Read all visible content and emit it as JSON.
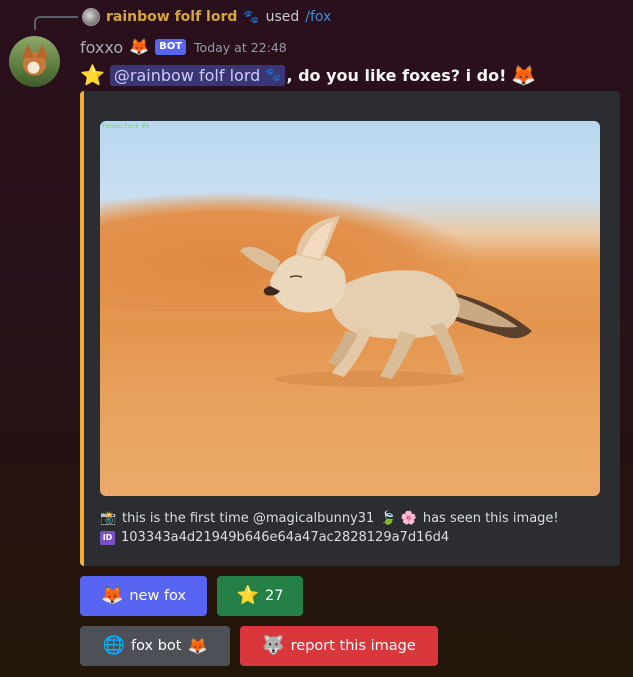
{
  "reply": {
    "username": "rainbow folf lord",
    "badge_emoji": "🐾",
    "used_text": "used",
    "command": "/fox"
  },
  "message": {
    "username": "foxxo",
    "username_emoji": "🦊",
    "bot_badge": "BOT",
    "timestamp": "Today at 22:48",
    "lead_emoji": "⭐",
    "mention": "@rainbow folf lord",
    "mention_emoji": "🐾",
    "text": ", do you like foxes? i do!",
    "trail_emoji": "🦊"
  },
  "embed": {
    "accent_color": "#f0b232",
    "image_tag": "fennecfox1 #1",
    "footer_line1_icon": "📸",
    "footer_line1": "this is the first time @magicalbunny31",
    "footer_line1_emojis": "🍃 🌸",
    "footer_line1_end": "has seen this image!",
    "footer_line2_icon": "ID",
    "footer_line2": "103343a4d21949b646e64a47ac2828129a7d16d4"
  },
  "buttons": {
    "new_fox": {
      "emoji": "🦊",
      "label": "new fox"
    },
    "star": {
      "emoji": "⭐",
      "label": "27"
    },
    "fox_bot": {
      "emoji": "🌐",
      "label": "fox bot",
      "trail_emoji": "🦊"
    },
    "report": {
      "emoji": "🐺",
      "label": "report this image"
    }
  },
  "colors": {
    "blurple": "#5865f2",
    "green": "#248046",
    "grey": "#4e5058",
    "red": "#da373c"
  }
}
